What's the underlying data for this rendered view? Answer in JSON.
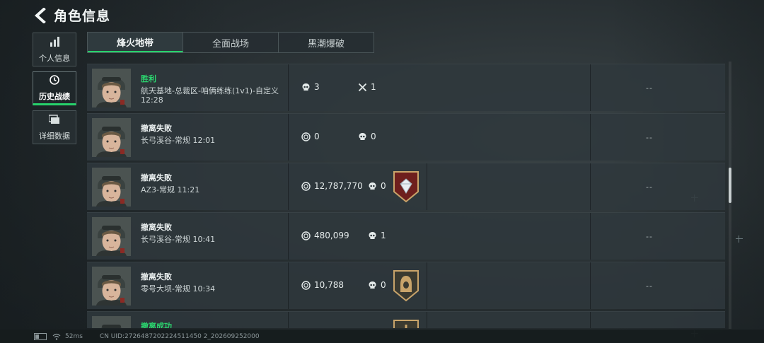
{
  "header": {
    "title": "角色信息"
  },
  "sidenav": [
    {
      "label": "个人信息",
      "icon": "bar-chart-icon",
      "active": false
    },
    {
      "label": "历史战绩",
      "icon": "clock-icon",
      "active": true
    },
    {
      "label": "详细数据",
      "icon": "folder-icon",
      "active": false
    }
  ],
  "tabs": [
    {
      "label": "烽火地带",
      "active": true
    },
    {
      "label": "全面战场",
      "active": false
    },
    {
      "label": "黑潮爆破",
      "active": false
    }
  ],
  "matches": [
    {
      "result": "胜利",
      "win": true,
      "detail": "航天基地-总裁区-咱俩练练(1v1)-自定义 12:28",
      "stat1": {
        "icon": "skull-icon",
        "value": "3"
      },
      "stat2": {
        "icon": "cross-swords-icon",
        "value": "1"
      },
      "badge": null,
      "extra": "--"
    },
    {
      "result": "撤离失败",
      "win": false,
      "detail": "长弓溪谷-常规 12:01",
      "stat1": {
        "icon": "coin-icon",
        "value": "0"
      },
      "stat2": {
        "icon": "skull-icon",
        "value": "0"
      },
      "badge": null,
      "extra": "--"
    },
    {
      "result": "撤离失败",
      "win": false,
      "detail": "AZ3-常规 11:21",
      "stat1": {
        "icon": "coin-icon",
        "value": "12,787,770"
      },
      "stat2": {
        "icon": "skull-icon",
        "value": "0"
      },
      "badge": "diamond-badge-icon",
      "extra": "--"
    },
    {
      "result": "撤离失败",
      "win": false,
      "detail": "长弓溪谷-常规 10:41",
      "stat1": {
        "icon": "coin-icon",
        "value": "480,099"
      },
      "stat2": {
        "icon": "skull-icon",
        "value": "1"
      },
      "badge": null,
      "extra": "--"
    },
    {
      "result": "撤离失败",
      "win": false,
      "detail": "零号大坝-常规 10:34",
      "stat1": {
        "icon": "coin-icon",
        "value": "10,788"
      },
      "stat2": {
        "icon": "skull-icon",
        "value": "0"
      },
      "badge": "hooded-badge-icon",
      "extra": "--"
    },
    {
      "result": "撤离成功",
      "win": true,
      "detail": "",
      "stat1": null,
      "stat2": null,
      "badge": "cross-badge-icon",
      "extra": ""
    }
  ],
  "footer": {
    "ping": "52ms",
    "uid": "CN UID:2726487202224511450 2_202609252000"
  },
  "colors": {
    "accent": "#27d26b",
    "win": "#2bd66f"
  }
}
